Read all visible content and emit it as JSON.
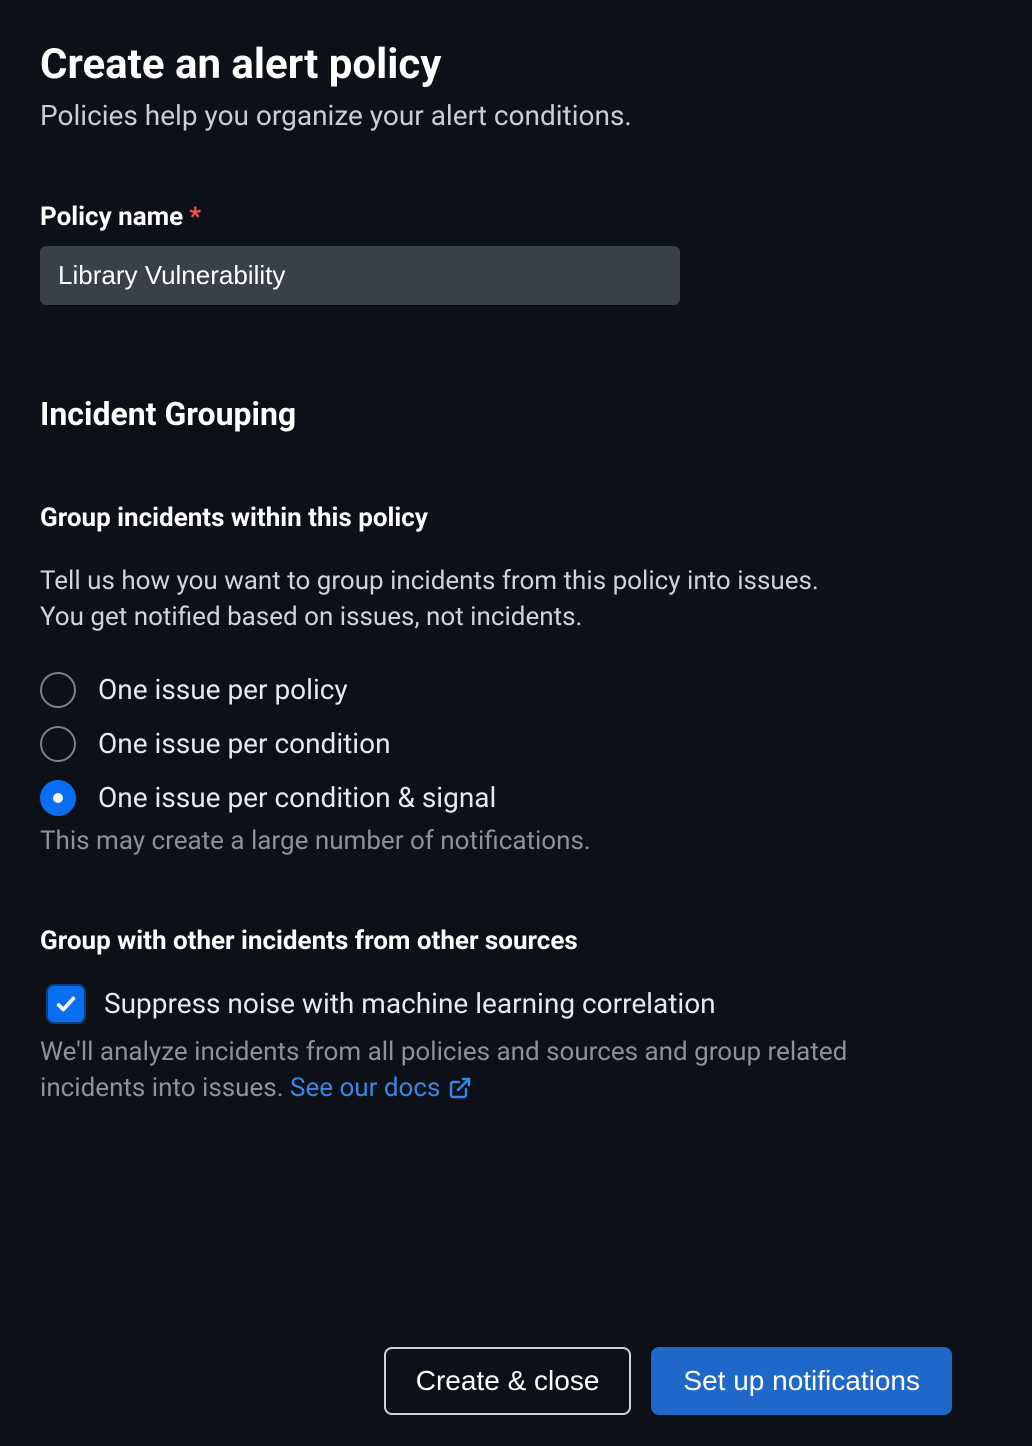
{
  "header": {
    "title": "Create an alert policy",
    "subtitle": "Policies help you organize your alert conditions."
  },
  "policy_name": {
    "label": "Policy name",
    "value": "Library Vulnerability"
  },
  "incident_grouping": {
    "title": "Incident Grouping",
    "group_within": {
      "title": "Group incidents within this policy",
      "desc": "Tell us how you want to group incidents from this policy into issues. You get notified based on issues, not incidents.",
      "options": {
        "per_policy": "One issue per policy",
        "per_condition": "One issue per condition",
        "per_condition_signal": "One issue per condition & signal"
      },
      "selected_hint": "This may create a large number of notifications."
    },
    "group_other": {
      "title": "Group with other incidents from other sources",
      "checkbox_label": "Suppress noise with machine learning correlation",
      "hint_prefix": "We'll analyze incidents from all policies and sources and group related incidents into issues. ",
      "docs_link_text": "See our docs"
    }
  },
  "buttons": {
    "create_close": "Create & close",
    "setup_notifications": "Set up notifications"
  }
}
